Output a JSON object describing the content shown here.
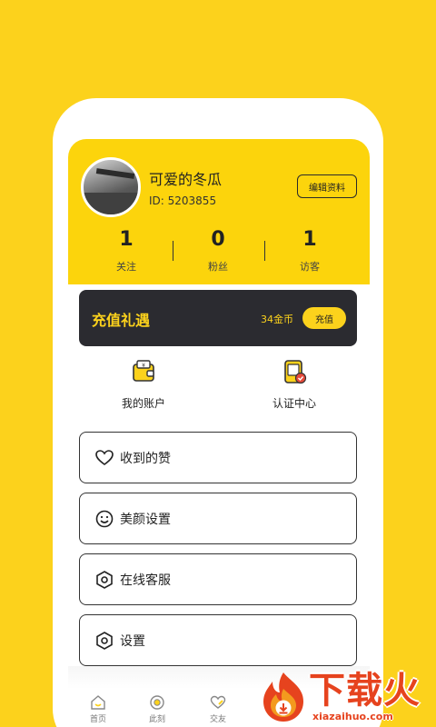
{
  "profile": {
    "username": "可爱的冬瓜",
    "id_label": "ID: 5203855",
    "edit_label": "编辑资料",
    "stats": [
      {
        "value": "1",
        "label": "关注"
      },
      {
        "value": "0",
        "label": "粉丝"
      },
      {
        "value": "1",
        "label": "访客"
      }
    ]
  },
  "recharge": {
    "title": "充值礼遇",
    "coins": "34金币",
    "button_label": "充值"
  },
  "quick_links": [
    {
      "label": "我的账户",
      "icon": "wallet-icon"
    },
    {
      "label": "认证中心",
      "icon": "verification-icon"
    }
  ],
  "menu": [
    {
      "label": "收到的赞",
      "icon": "heart-icon"
    },
    {
      "label": "美颜设置",
      "icon": "smile-icon"
    },
    {
      "label": "在线客服",
      "icon": "service-icon"
    },
    {
      "label": "设置",
      "icon": "settings-icon"
    }
  ],
  "tabs": [
    {
      "label": "首页",
      "icon": "home-icon"
    },
    {
      "label": "此刻",
      "icon": "moment-icon"
    },
    {
      "label": "交友",
      "icon": "friends-heart-icon"
    }
  ],
  "watermark": {
    "title": "下载火",
    "url": "xiazaihuo.com"
  },
  "colors": {
    "background": "#FCD21C",
    "accent": "#FCD40C",
    "dark_card": "#2B2B30",
    "watermark": "#E6431E"
  }
}
